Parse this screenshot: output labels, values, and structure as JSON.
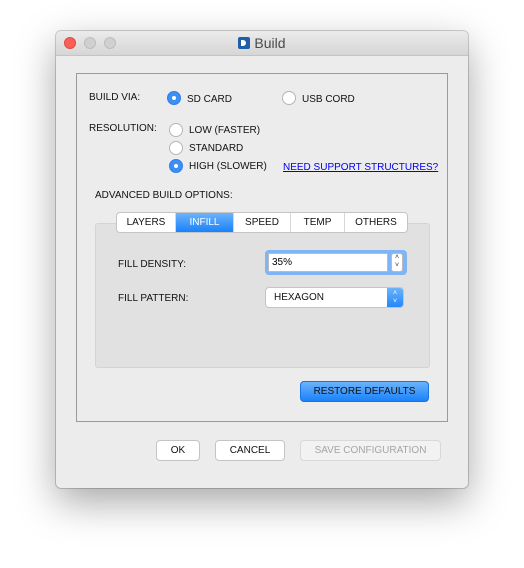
{
  "window": {
    "title": "Build",
    "accent": "#3d8ff5"
  },
  "build_via": {
    "label": "BUILD VIA:",
    "options": [
      {
        "label": "SD CARD",
        "selected": true
      },
      {
        "label": "USB CORD",
        "selected": false
      }
    ]
  },
  "resolution": {
    "label": "RESOLUTION:",
    "options": [
      {
        "label": "LOW (FASTER)",
        "selected": false
      },
      {
        "label": "STANDARD",
        "selected": false
      },
      {
        "label": "HIGH (SLOWER)",
        "selected": true
      }
    ],
    "support_link": "NEED SUPPORT STRUCTURES?"
  },
  "advanced": {
    "label": "ADVANCED BUILD OPTIONS:",
    "tabs": [
      "LAYERS",
      "INFILL",
      "SPEED",
      "TEMP",
      "OTHERS"
    ],
    "active_tab": "INFILL",
    "fill_density": {
      "label": "FILL DENSITY:",
      "value": "35%"
    },
    "fill_pattern": {
      "label": "FILL PATTERN:",
      "value": "HEXAGON"
    },
    "restore": "RESTORE DEFAULTS"
  },
  "footer": {
    "ok": "OK",
    "cancel": "CANCEL",
    "save": "SAVE CONFIGURATION"
  }
}
